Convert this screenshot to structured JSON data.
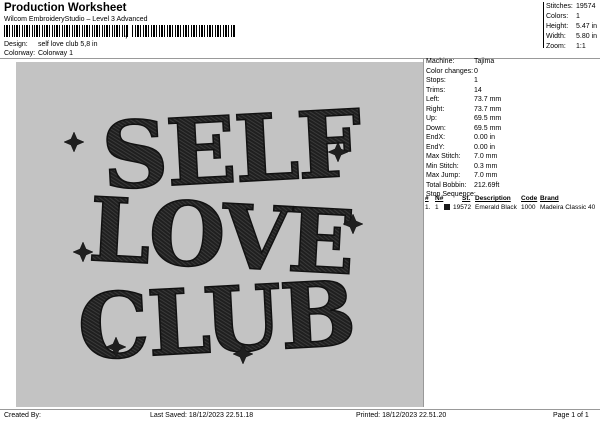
{
  "header": {
    "title": "Production Worksheet",
    "subtitle": "Wilcom EmbroideryStudio – Level 3 Advanced",
    "barcode_mark": ","
  },
  "meta": {
    "design_label": "Design:",
    "design_value": "self love club 5,8 in",
    "colorway_label": "Colorway:",
    "colorway_value": "Colorway 1"
  },
  "stats": [
    {
      "label": "Stitches:",
      "value": "19574"
    },
    {
      "label": "Colors:",
      "value": "1"
    },
    {
      "label": "Height:",
      "value": "5.47 in"
    },
    {
      "label": "Width:",
      "value": "5.80 in"
    },
    {
      "label": "Zoom:",
      "value": "1:1"
    }
  ],
  "machine_info": [
    {
      "label": "Machine:",
      "value": "Tajima"
    },
    {
      "label": "Color changes:",
      "value": "0"
    },
    {
      "label": "Stops:",
      "value": "1"
    },
    {
      "label": "Trims:",
      "value": "14"
    },
    {
      "label": "Left:",
      "value": "73.7 mm"
    },
    {
      "label": "Right:",
      "value": "73.7 mm"
    },
    {
      "label": "Up:",
      "value": "69.5 mm"
    },
    {
      "label": "Down:",
      "value": "69.5 mm"
    },
    {
      "label": "EndX:",
      "value": "0.00 in"
    },
    {
      "label": "EndY:",
      "value": "0.00 in"
    },
    {
      "label": "Max Stitch:",
      "value": "7.0 mm"
    },
    {
      "label": "Min Stitch:",
      "value": "0.3 mm"
    },
    {
      "label": "Max Jump:",
      "value": "7.0 mm"
    },
    {
      "label": "Total Bobbin:",
      "value": "212.69ft"
    }
  ],
  "stop_sequence": {
    "title": "Stop Sequence:",
    "headers": [
      "#",
      "N#",
      "St.",
      "Description",
      "Code",
      "Brand"
    ],
    "rows": [
      {
        "num": "1.",
        "n": "1",
        "stitches": "19572",
        "description": "Emerald Black",
        "code": "1000",
        "brand": "Madeira Classic 40",
        "color": "#1a1a1a"
      }
    ]
  },
  "design": {
    "lines": [
      "SELF",
      "LOVE",
      "CLUB"
    ],
    "thread_color": "#1f1f1f",
    "background_color": "#c3c3c3"
  },
  "footer": {
    "created_by": "Created By:",
    "last_saved": "Last Saved: 18/12/2023 22.51.18",
    "printed": "Printed: 18/12/2023 22.51.20",
    "page": "Page 1 of 1"
  }
}
